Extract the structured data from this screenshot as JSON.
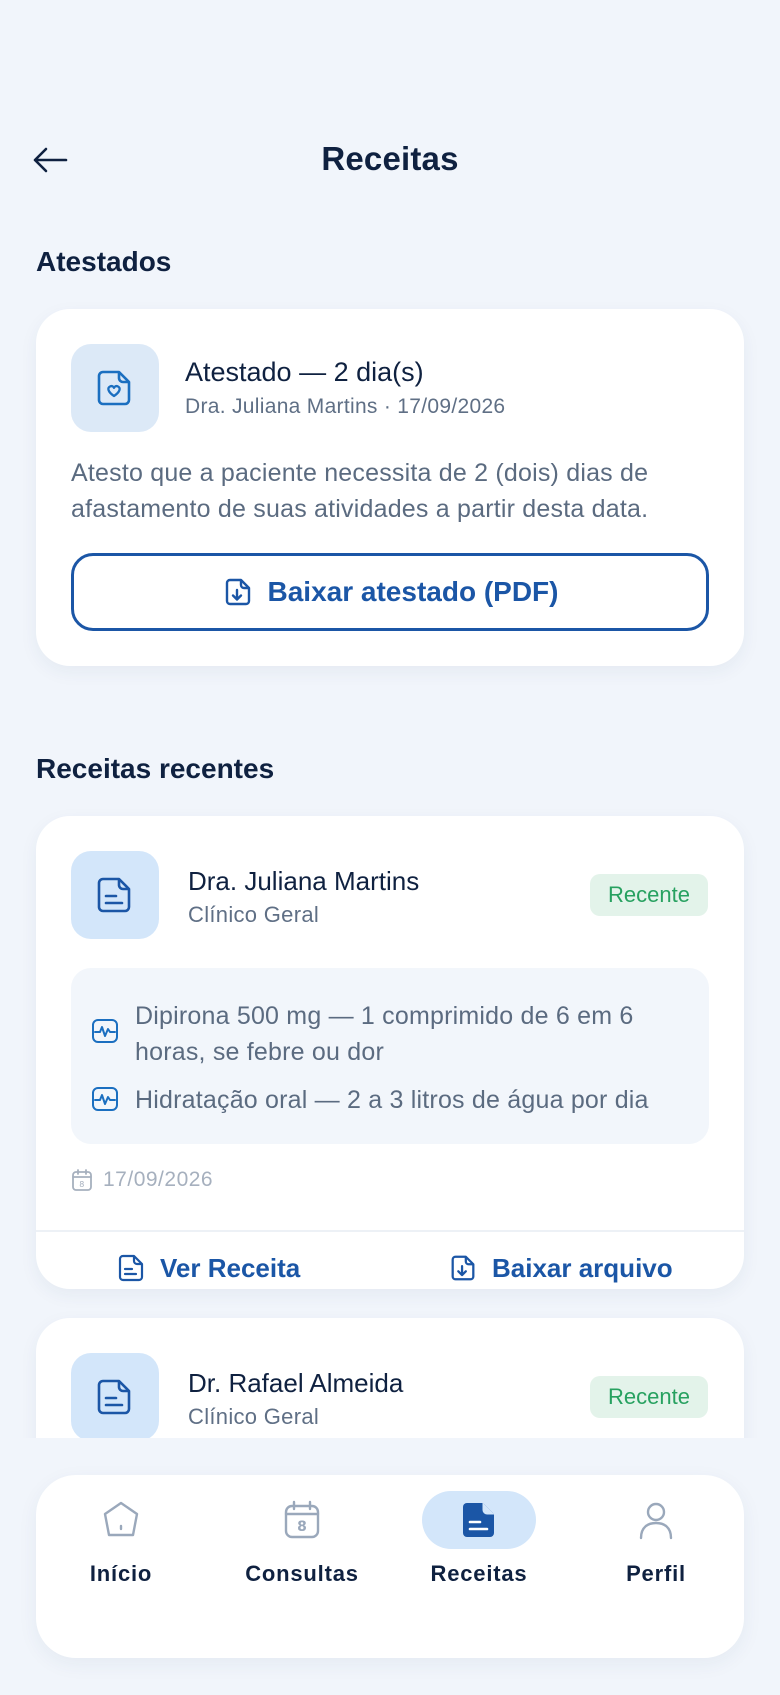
{
  "header": {
    "title": "Receitas"
  },
  "certificates": {
    "section_title": "Atestados",
    "card": {
      "title": "Atestado — 2 dia(s)",
      "subtitle": "Dra. Juliana Martins · 17/09/2026",
      "description": "Atesto que a paciente necessita de 2 (dois) dias de afastamento de suas atividades a partir desta data.",
      "download_label": "Baixar atestado (PDF)"
    }
  },
  "prescriptions": {
    "section_title": "Receitas recentes",
    "items": [
      {
        "doctor": "Dra. Juliana Martins",
        "specialty": "Clínico Geral",
        "badge": "Recente",
        "medications": [
          "Dipirona 500 mg — 1 comprimido de 6 em 6 horas, se febre ou dor",
          "Hidratação oral — 2 a 3 litros de água por dia"
        ],
        "date": "17/09/2026",
        "view_label": "Ver Receita",
        "download_label": "Baixar arquivo"
      },
      {
        "doctor": "Dr. Rafael Almeida",
        "specialty": "Clínico Geral",
        "badge": "Recente"
      }
    ]
  },
  "tabbar": {
    "items": [
      {
        "label": "Início",
        "icon": "home-icon"
      },
      {
        "label": "Consultas",
        "icon": "calendar-icon",
        "icon_text": "8"
      },
      {
        "label": "Receitas",
        "icon": "document-icon",
        "active": true
      },
      {
        "label": "Perfil",
        "icon": "user-icon"
      }
    ]
  },
  "colors": {
    "primary": "#1b56a6",
    "badge_text": "#27a160",
    "badge_bg": "#e3f3ea",
    "background": "#f1f5fb"
  }
}
